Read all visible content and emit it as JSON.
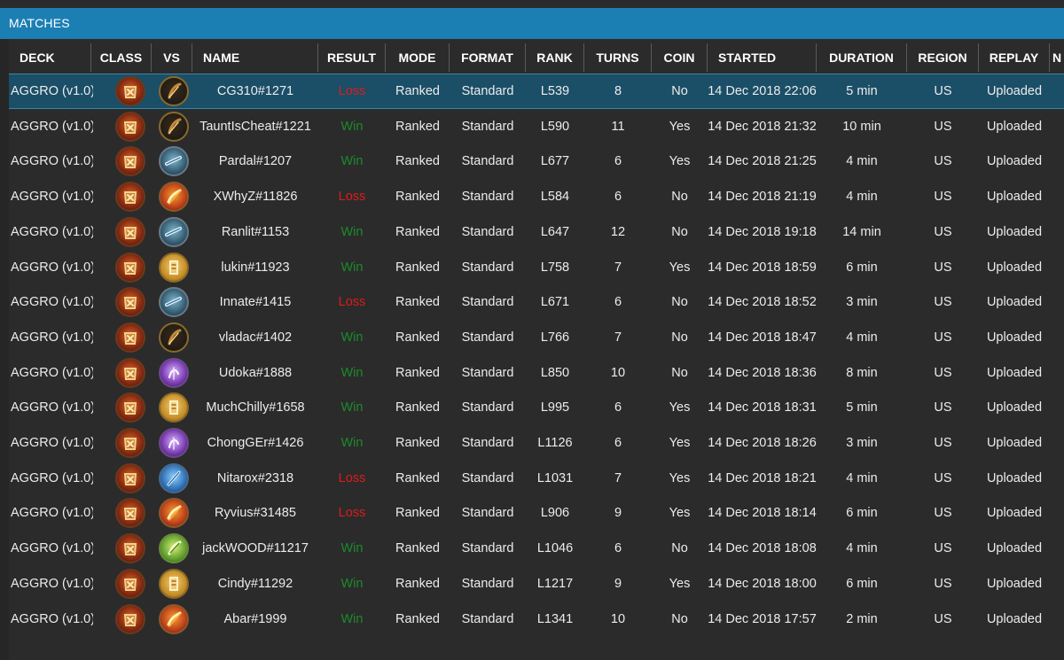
{
  "window": {
    "title": "MATCHES"
  },
  "columns": [
    {
      "key": "deck",
      "label": "DECK"
    },
    {
      "key": "class",
      "label": "CLASS"
    },
    {
      "key": "vs",
      "label": "VS"
    },
    {
      "key": "name",
      "label": "NAME"
    },
    {
      "key": "result",
      "label": "RESULT"
    },
    {
      "key": "mode",
      "label": "MODE"
    },
    {
      "key": "format",
      "label": "FORMAT"
    },
    {
      "key": "rank",
      "label": "RANK"
    },
    {
      "key": "turns",
      "label": "TURNS"
    },
    {
      "key": "coin",
      "label": "COIN"
    },
    {
      "key": "started",
      "label": "STARTED"
    },
    {
      "key": "duration",
      "label": "DURATION"
    },
    {
      "key": "region",
      "label": "REGION"
    },
    {
      "key": "replay",
      "label": "REPLAY"
    },
    {
      "key": "note",
      "label": "N"
    }
  ],
  "colors": {
    "accent": "#1c7fb4",
    "win": "#1c8b2b",
    "loss": "#e01a1a",
    "selected_row": "#1b4e67"
  },
  "matches": [
    {
      "deck": "AGGRO (v1.0)",
      "class_icon": "rogue-icon",
      "vs_icon": "hunter-icon",
      "name": "CG310#1271",
      "result": "Loss",
      "mode": "Ranked",
      "format": "Standard",
      "rank": "L539",
      "turns": "8",
      "coin": "No",
      "started": "14 Dec 2018 22:06",
      "duration": "5 min",
      "region": "US",
      "replay": "Uploaded",
      "selected": true
    },
    {
      "deck": "AGGRO (v1.0)",
      "class_icon": "rogue-icon",
      "vs_icon": "hunter-icon",
      "name": "TauntIsCheat#1221",
      "result": "Win",
      "mode": "Ranked",
      "format": "Standard",
      "rank": "L590",
      "turns": "11",
      "coin": "Yes",
      "started": "14 Dec 2018 21:32",
      "duration": "10 min",
      "region": "US",
      "replay": "Uploaded"
    },
    {
      "deck": "AGGRO (v1.0)",
      "class_icon": "rogue-icon",
      "vs_icon": "warrior-icon",
      "name": "Pardal#1207",
      "result": "Win",
      "mode": "Ranked",
      "format": "Standard",
      "rank": "L677",
      "turns": "6",
      "coin": "Yes",
      "started": "14 Dec 2018 21:25",
      "duration": "4 min",
      "region": "US",
      "replay": "Uploaded"
    },
    {
      "deck": "AGGRO (v1.0)",
      "class_icon": "rogue-icon",
      "vs_icon": "mage-icon",
      "name": "XWhyZ#11826",
      "result": "Loss",
      "mode": "Ranked",
      "format": "Standard",
      "rank": "L584",
      "turns": "6",
      "coin": "No",
      "started": "14 Dec 2018 21:19",
      "duration": "4 min",
      "region": "US",
      "replay": "Uploaded"
    },
    {
      "deck": "AGGRO (v1.0)",
      "class_icon": "rogue-icon",
      "vs_icon": "warrior-icon",
      "name": "Ranlit#1153",
      "result": "Win",
      "mode": "Ranked",
      "format": "Standard",
      "rank": "L647",
      "turns": "12",
      "coin": "No",
      "started": "14 Dec 2018 19:18",
      "duration": "14 min",
      "region": "US",
      "replay": "Uploaded"
    },
    {
      "deck": "AGGRO (v1.0)",
      "class_icon": "rogue-icon",
      "vs_icon": "paladin-icon",
      "name": "lukin#11923",
      "result": "Win",
      "mode": "Ranked",
      "format": "Standard",
      "rank": "L758",
      "turns": "7",
      "coin": "Yes",
      "started": "14 Dec 2018 18:59",
      "duration": "6 min",
      "region": "US",
      "replay": "Uploaded"
    },
    {
      "deck": "AGGRO (v1.0)",
      "class_icon": "rogue-icon",
      "vs_icon": "warrior-icon",
      "name": "Innate#1415",
      "result": "Loss",
      "mode": "Ranked",
      "format": "Standard",
      "rank": "L671",
      "turns": "6",
      "coin": "No",
      "started": "14 Dec 2018 18:52",
      "duration": "3 min",
      "region": "US",
      "replay": "Uploaded"
    },
    {
      "deck": "AGGRO (v1.0)",
      "class_icon": "rogue-icon",
      "vs_icon": "hunter-icon",
      "name": "vladac#1402",
      "result": "Win",
      "mode": "Ranked",
      "format": "Standard",
      "rank": "L766",
      "turns": "7",
      "coin": "No",
      "started": "14 Dec 2018 18:47",
      "duration": "4 min",
      "region": "US",
      "replay": "Uploaded"
    },
    {
      "deck": "AGGRO (v1.0)",
      "class_icon": "rogue-icon",
      "vs_icon": "warlock-icon",
      "name": "Udoka#1888",
      "result": "Win",
      "mode": "Ranked",
      "format": "Standard",
      "rank": "L850",
      "turns": "10",
      "coin": "No",
      "started": "14 Dec 2018 18:36",
      "duration": "8 min",
      "region": "US",
      "replay": "Uploaded"
    },
    {
      "deck": "AGGRO (v1.0)",
      "class_icon": "rogue-icon",
      "vs_icon": "paladin-icon",
      "name": "MuchChilly#1658",
      "result": "Win",
      "mode": "Ranked",
      "format": "Standard",
      "rank": "L995",
      "turns": "6",
      "coin": "Yes",
      "started": "14 Dec 2018 18:31",
      "duration": "5 min",
      "region": "US",
      "replay": "Uploaded"
    },
    {
      "deck": "AGGRO (v1.0)",
      "class_icon": "rogue-icon",
      "vs_icon": "warlock-icon",
      "name": "ChongGEr#1426",
      "result": "Win",
      "mode": "Ranked",
      "format": "Standard",
      "rank": "L1126",
      "turns": "6",
      "coin": "Yes",
      "started": "14 Dec 2018 18:26",
      "duration": "3 min",
      "region": "US",
      "replay": "Uploaded"
    },
    {
      "deck": "AGGRO (v1.0)",
      "class_icon": "rogue-icon",
      "vs_icon": "shaman-icon",
      "name": "Nitarox#2318",
      "result": "Loss",
      "mode": "Ranked",
      "format": "Standard",
      "rank": "L1031",
      "turns": "7",
      "coin": "Yes",
      "started": "14 Dec 2018 18:21",
      "duration": "4 min",
      "region": "US",
      "replay": "Uploaded"
    },
    {
      "deck": "AGGRO (v1.0)",
      "class_icon": "rogue-icon",
      "vs_icon": "mage-icon",
      "name": "Ryvius#31485",
      "result": "Loss",
      "mode": "Ranked",
      "format": "Standard",
      "rank": "L906",
      "turns": "9",
      "coin": "Yes",
      "started": "14 Dec 2018 18:14",
      "duration": "6 min",
      "region": "US",
      "replay": "Uploaded"
    },
    {
      "deck": "AGGRO (v1.0)",
      "class_icon": "rogue-icon",
      "vs_icon": "druid-icon",
      "name": "jackWOOD#11217",
      "result": "Win",
      "mode": "Ranked",
      "format": "Standard",
      "rank": "L1046",
      "turns": "6",
      "coin": "No",
      "started": "14 Dec 2018 18:08",
      "duration": "4 min",
      "region": "US",
      "replay": "Uploaded"
    },
    {
      "deck": "AGGRO (v1.0)",
      "class_icon": "rogue-icon",
      "vs_icon": "paladin-icon",
      "name": "Cindy#11292",
      "result": "Win",
      "mode": "Ranked",
      "format": "Standard",
      "rank": "L1217",
      "turns": "9",
      "coin": "Yes",
      "started": "14 Dec 2018 18:00",
      "duration": "6 min",
      "region": "US",
      "replay": "Uploaded"
    },
    {
      "deck": "AGGRO (v1.0)",
      "class_icon": "rogue-icon",
      "vs_icon": "mage-icon",
      "name": "Abar#1999",
      "result": "Win",
      "mode": "Ranked",
      "format": "Standard",
      "rank": "L1341",
      "turns": "10",
      "coin": "No",
      "started": "14 Dec 2018 17:57",
      "duration": "2 min",
      "region": "US",
      "replay": "Uploaded"
    }
  ]
}
